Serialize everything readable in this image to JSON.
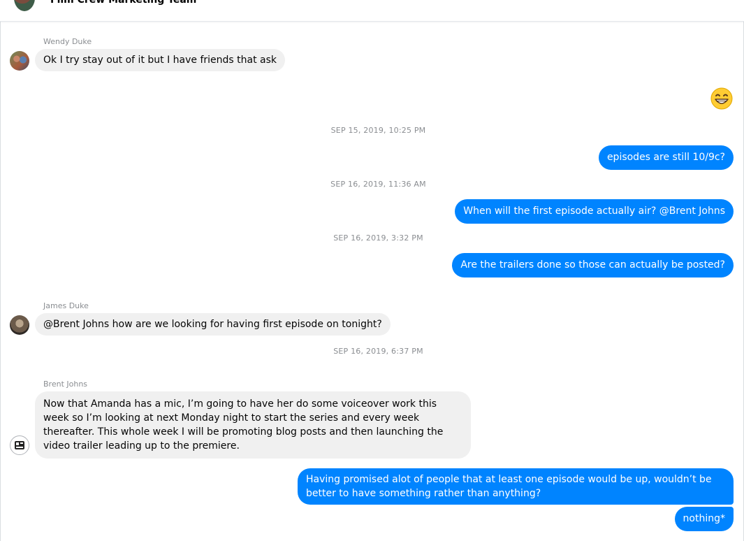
{
  "header": {
    "title": "Film Crew Marketing Team"
  },
  "messages": {
    "m1": {
      "sender": "Wendy Duke",
      "text": "Ok I try stay out of it but I have friends that ask"
    },
    "emoji": {
      "icon": "grinning-face-with-smiling-eyes",
      "glyph": "😁"
    },
    "ts1": "SEP 15, 2019, 10:25 PM",
    "m2": {
      "text": "episodes are still 10/9c?"
    },
    "ts2": "SEP 16, 2019, 11:36 AM",
    "m3": {
      "text": "When will the first episode actually air? @Brent Johns"
    },
    "ts3": "SEP 16, 2019, 3:32 PM",
    "m4": {
      "text": "Are the trailers done so those can actually be posted?"
    },
    "m5": {
      "sender": "James Duke",
      "text": "@Brent Johns  how are we looking for having first episode on tonight?"
    },
    "ts4": "SEP 16, 2019, 6:37 PM",
    "m6": {
      "sender": "Brent Johns",
      "text": "Now that Amanda has a mic, I’m going to have her do some voiceover work this week so I’m looking at next Monday night to start the series and every week thereafter. This whole week I will be promoting blog posts and then launching the video trailer leading up to the premiere."
    },
    "m7": {
      "text": "Having promised alot of people that at least one episode would be up, wouldn’t be better to have something rather than anything?"
    },
    "m8": {
      "text": "nothing*"
    }
  },
  "colors": {
    "outgoing_bubble": "#0084ff",
    "incoming_bubble": "#f0f0f0",
    "meta_text": "#8a8d91"
  }
}
